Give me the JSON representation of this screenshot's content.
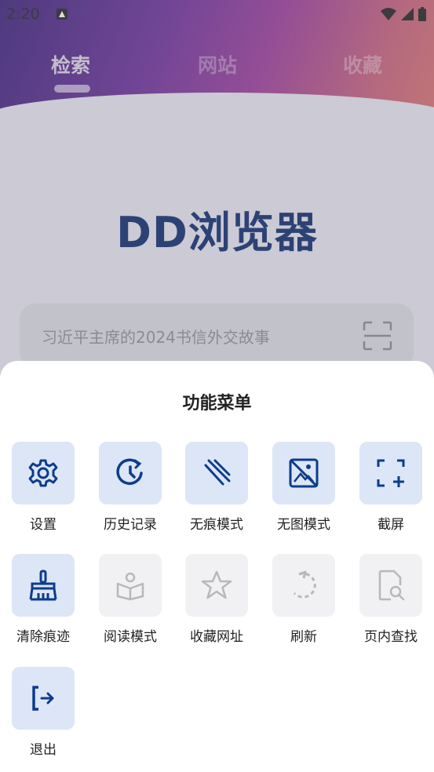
{
  "status": {
    "time": "2:20"
  },
  "tabs": [
    {
      "label": "检索",
      "active": true
    },
    {
      "label": "网站",
      "active": false
    },
    {
      "label": "收藏",
      "active": false
    }
  ],
  "logo": "DD浏览器",
  "search": {
    "placeholder": "习近平主席的2024书信外交故事"
  },
  "menu": {
    "title": "功能菜单",
    "items": [
      {
        "label": "设置",
        "icon": "gear-icon",
        "enabled": true
      },
      {
        "label": "历史记录",
        "icon": "history-icon",
        "enabled": true
      },
      {
        "label": "无痕模式",
        "icon": "incognito-icon",
        "enabled": true
      },
      {
        "label": "无图模式",
        "icon": "no-image-icon",
        "enabled": true
      },
      {
        "label": "截屏",
        "icon": "screenshot-icon",
        "enabled": true
      },
      {
        "label": "清除痕迹",
        "icon": "broom-icon",
        "enabled": true
      },
      {
        "label": "阅读模式",
        "icon": "reader-icon",
        "enabled": false
      },
      {
        "label": "收藏网址",
        "icon": "star-icon",
        "enabled": false
      },
      {
        "label": "刷新",
        "icon": "refresh-icon",
        "enabled": false
      },
      {
        "label": "页内查找",
        "icon": "find-in-page-icon",
        "enabled": false
      },
      {
        "label": "退出",
        "icon": "exit-icon",
        "enabled": true
      }
    ]
  },
  "colors": {
    "active_icon": "#0d3c8c",
    "inactive_icon": "#b8b8bc",
    "active_tile": "#dce6f6",
    "inactive_tile": "#f1f1f3"
  }
}
